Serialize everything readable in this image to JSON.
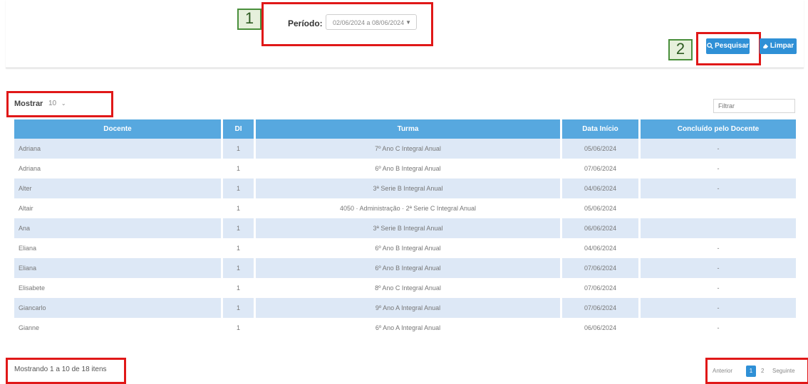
{
  "filters": {
    "period_label": "Período:",
    "period_value": "02/06/2024 a 08/06/2024",
    "search_button": "Pesquisar",
    "clear_button": "Limpar"
  },
  "markers": {
    "step1": "1",
    "step2": "2"
  },
  "table_controls": {
    "length_label": "Mostrar",
    "length_value": "10",
    "filter_placeholder": "Filtrar"
  },
  "table": {
    "headers": [
      "Docente",
      "DI",
      "Turma",
      "Data Início",
      "Concluído pelo Docente"
    ],
    "rows": [
      [
        "Adriana",
        "1",
        "7º Ano C Integral Anual",
        "05/06/2024",
        "-"
      ],
      [
        "Adriana",
        "1",
        "6º Ano B Integral Anual",
        "07/06/2024",
        "-"
      ],
      [
        "Alter",
        "1",
        "3ª Serie B Integral Anual",
        "04/06/2024",
        "-"
      ],
      [
        "Altair",
        "1",
        "4050 · Administração · 2ª Serie C Integral Anual",
        "05/06/2024",
        ""
      ],
      [
        "Ana",
        "1",
        "3ª Serie B Integral Anual",
        "06/06/2024",
        ""
      ],
      [
        "Eliana",
        "1",
        "6º Ano B Integral Anual",
        "04/06/2024",
        "-"
      ],
      [
        "Eliana",
        "1",
        "6º Ano B Integral Anual",
        "07/06/2024",
        "-"
      ],
      [
        "Elisabete",
        "1",
        "8º Ano C Integral Anual",
        "07/06/2024",
        "-"
      ],
      [
        "Giancarlo",
        "1",
        "9º Ano A Integral Anual",
        "07/06/2024",
        "-"
      ],
      [
        "Gianne",
        "1",
        "6º Ano A Integral Anual",
        "06/06/2024",
        "-"
      ]
    ]
  },
  "footer": {
    "info": "Mostrando 1 a 10 de 18 itens",
    "previous": "Anterior",
    "pages": [
      "1",
      "2"
    ],
    "next": "Seguinte"
  },
  "colors": {
    "accent": "#2f90d6",
    "header_bg": "#57a8df",
    "row_stripe": "#dde8f6",
    "highlight": "#e01818",
    "marker": "#4a8f3c"
  }
}
